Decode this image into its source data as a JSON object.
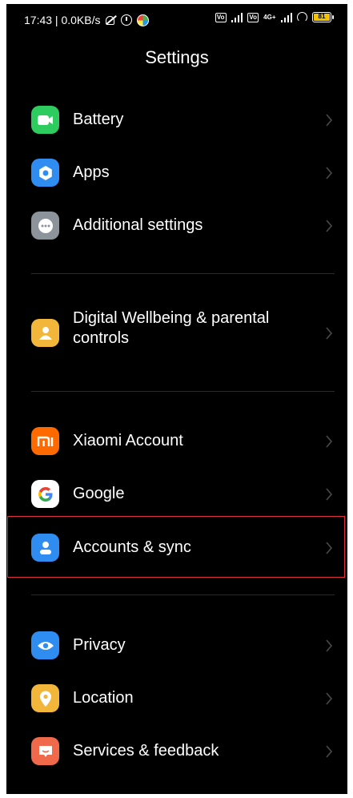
{
  "status_bar": {
    "time": "17:43 | 0.0KB/s",
    "volte1": "Vo LTE",
    "network_type": "4G+",
    "volte2": "Vo LTE",
    "battery_level": "81",
    "battery_color": "#f2c400"
  },
  "header": {
    "title": "Settings"
  },
  "settings_items": [
    {
      "label": "Battery",
      "icon": "battery-icon",
      "color": "#2ecc5e"
    },
    {
      "label": "Apps",
      "icon": "gear-icon",
      "color": "#2f8cf0"
    },
    {
      "label": "Additional settings",
      "icon": "more-dots-icon",
      "color": "#8d939b"
    },
    {
      "label": "Digital Wellbeing & parental controls",
      "icon": "wellbeing-person-icon",
      "color": "#f2b63a"
    },
    {
      "label": "Xiaomi Account",
      "icon": "mi-logo-icon",
      "color": "#ff6a00"
    },
    {
      "label": "Google",
      "icon": "google-g-icon",
      "color": "#ffffff"
    },
    {
      "label": "Accounts & sync",
      "icon": "person-icon",
      "color": "#2f8cf0"
    },
    {
      "label": "Privacy",
      "icon": "eye-icon",
      "color": "#2f8cf0"
    },
    {
      "label": "Location",
      "icon": "location-pin-icon",
      "color": "#f2b63a"
    },
    {
      "label": "Services & feedback",
      "icon": "feedback-icon",
      "color": "#f0694a"
    }
  ],
  "highlight_color": "#e0303a"
}
